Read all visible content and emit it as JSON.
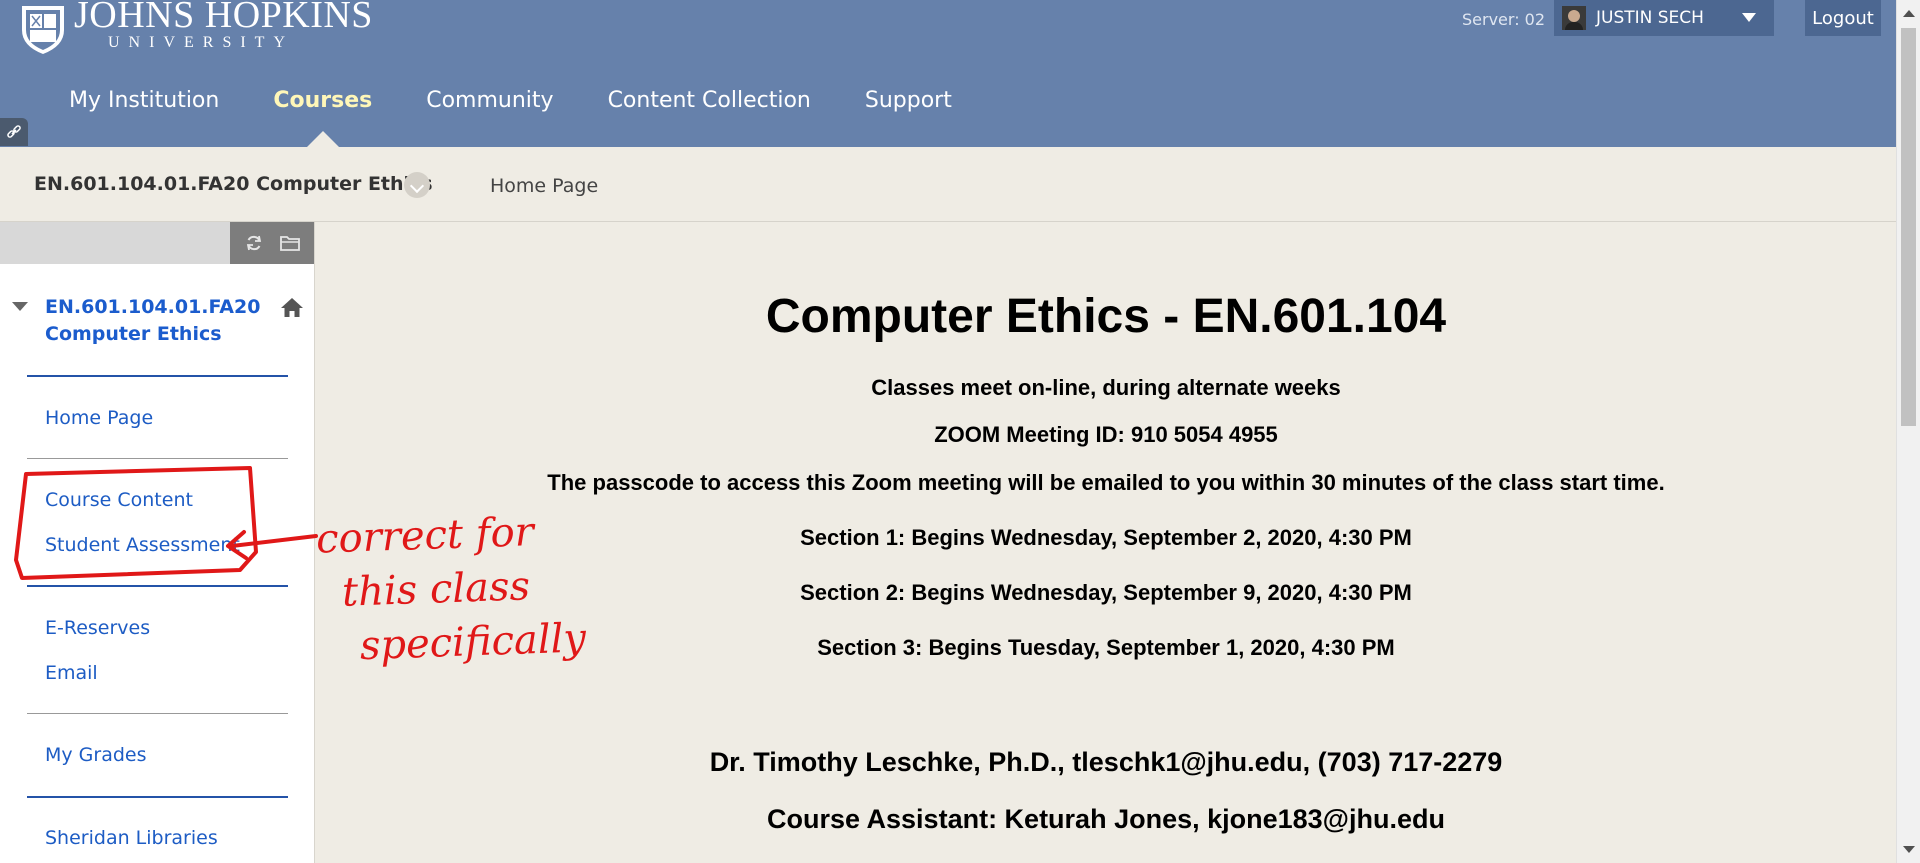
{
  "header": {
    "logo_line1": "JOHNS HOPKINS",
    "logo_line2": "UNIVERSITY",
    "server": "Server: 02",
    "user_name": "JUSTIN SECH",
    "logout": "Logout",
    "tabs": [
      {
        "label": "My Institution",
        "active": false
      },
      {
        "label": "Courses",
        "active": true
      },
      {
        "label": "Community",
        "active": false
      },
      {
        "label": "Content Collection",
        "active": false
      },
      {
        "label": "Support",
        "active": false
      }
    ]
  },
  "breadcrumb": {
    "course": "EN.601.104.01.FA20 Computer Ethics",
    "page": "Home Page"
  },
  "sidebar": {
    "course_title": "EN.601.104.01.FA20 Computer Ethics",
    "items": [
      {
        "label": "Home Page"
      },
      {
        "label": "Course Content"
      },
      {
        "label": "Student Assessment"
      },
      {
        "label": "E-Reserves"
      },
      {
        "label": "Email"
      },
      {
        "label": "My Grades"
      },
      {
        "label": "Sheridan Libraries"
      }
    ]
  },
  "content": {
    "title": "Computer Ethics - EN.601.104",
    "lines": [
      "Classes meet on-line, during alternate weeks",
      "ZOOM Meeting ID:  910 5054 4955",
      "The passcode to access this Zoom meeting will be emailed to you within 30 minutes of the class start time.",
      "Section 1: Begins Wednesday, September 2, 2020, 4:30 PM",
      "Section 2: Begins Wednesday, September 9, 2020, 4:30 PM",
      "Section 3: Begins Tuesday, September 1, 2020, 4:30 PM"
    ],
    "instructor": "Dr. Timothy Leschke, Ph.D., tleschk1@jhu.edu, (703) 717-2279",
    "assistant": "Course Assistant: Keturah Jones, kjone183@jhu.edu"
  },
  "annotation": {
    "line1": "correct for",
    "line2": "this class",
    "line3": "specifically",
    "color": "#e01818"
  },
  "colors": {
    "header_bg": "#6681ab",
    "active_tab": "#fff7b8",
    "link": "#1d5cc4",
    "page_bg": "#efece4"
  }
}
